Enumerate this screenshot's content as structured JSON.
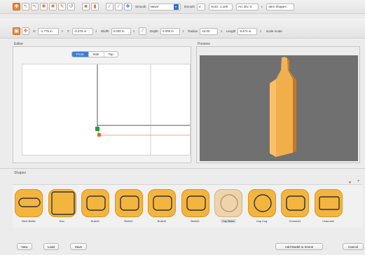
{
  "toolbar1": {
    "smooth_label": "Smooth",
    "smooth_value": "Never",
    "smooth_qty_label": "Smooth",
    "smooth_qty_value": "4",
    "vert_divs_label": "Horiz. 1.100",
    "arc_divs_label": "Arc Div: 6",
    "item_shapes_label": "Item Shapes"
  },
  "toolbar2": {
    "x_label": "X:",
    "x_value": "-1.775 in",
    "y_label": "Y:",
    "y_value": "-0.275 in",
    "width_label": "Width",
    "width_value": "0.000 in",
    "depth_label": "Depth",
    "depth_value": "0.000 in",
    "radius_label": "Radius",
    "radius_value": "15.00",
    "length_label": "Length",
    "length_value": "5.474 in",
    "scale_label": "scale mode"
  },
  "editor": {
    "title": "Editor",
    "tabs": [
      "Front",
      "Side",
      "Top"
    ],
    "active_tab": "Front"
  },
  "preview": {
    "title": "Preview"
  },
  "shapes": {
    "title": "Shapes",
    "items": [
      {
        "label": "Bent Bottle",
        "icon": "rounded-bar-icon"
      },
      {
        "label": "Box",
        "icon": "square-icon"
      },
      {
        "label": "Bullet1",
        "icon": "rounded-rect-icon"
      },
      {
        "label": "Bullet2",
        "icon": "rounded-rect-icon"
      },
      {
        "label": "Bullet3",
        "icon": "rounded-rect-icon"
      },
      {
        "label": "Bullet4",
        "icon": "rounded-rect-icon"
      },
      {
        "label": "Cap Base",
        "icon": "circle-icon"
      },
      {
        "label": "Cap Cog",
        "icon": "circle-icon"
      },
      {
        "label": "Channel1",
        "icon": "rounded-rect-icon"
      },
      {
        "label": "Channel2",
        "icon": "rect-icon"
      }
    ],
    "selected": "Cap Base"
  },
  "buttons": {
    "new": "New",
    "load": "Load",
    "save": "Save",
    "add_to_scene": "Add Model to Scene",
    "cancel": "Cancel"
  },
  "colors": {
    "accent_orange": "#f4b53f",
    "tab_blue": "#3d7fd6",
    "preview_bg": "#707070",
    "model_orange": "#f0a844"
  }
}
